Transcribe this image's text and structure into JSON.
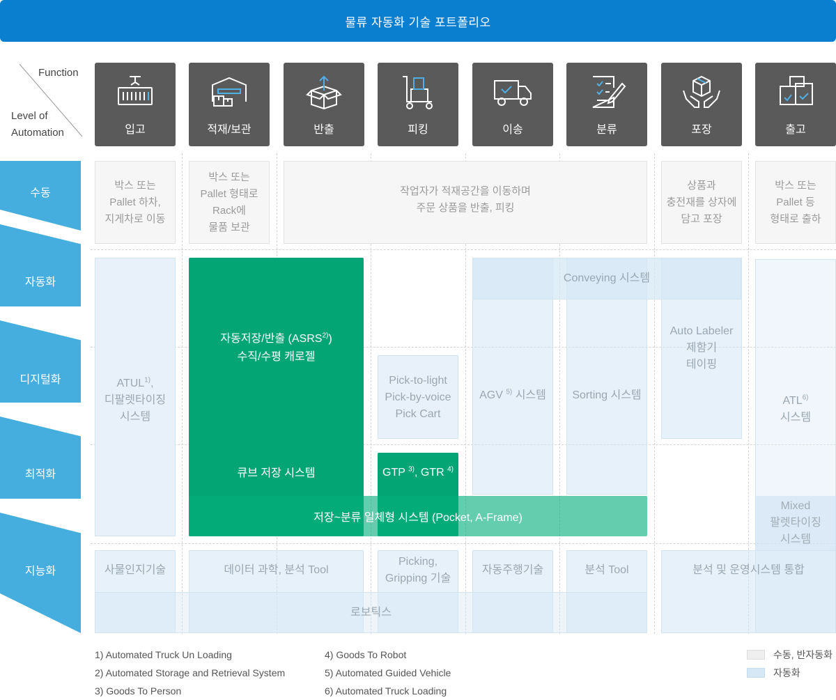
{
  "title": "물류 자동화 기술 포트폴리오",
  "axes": {
    "function_label": "Function",
    "level_label_1": "Level of",
    "level_label_2": "Automation"
  },
  "functions": [
    {
      "label": "입고",
      "icon": "container-crane-icon"
    },
    {
      "label": "적재/보관",
      "icon": "warehouse-boxes-icon"
    },
    {
      "label": "반출",
      "icon": "open-box-arrow-icon"
    },
    {
      "label": "피킹",
      "icon": "hand-truck-icon"
    },
    {
      "label": "이송",
      "icon": "delivery-truck-icon"
    },
    {
      "label": "분류",
      "icon": "checklist-pen-icon"
    },
    {
      "label": "포장",
      "icon": "hands-box-icon"
    },
    {
      "label": "출고",
      "icon": "stacked-boxes-icon"
    }
  ],
  "levels": [
    "수동",
    "자동화",
    "디지털화",
    "최적화",
    "지능화"
  ],
  "manual": {
    "inbound": [
      "박스 또는",
      "Pallet 하차,",
      "지게차로 이동"
    ],
    "storage": [
      "박스 또는",
      "Pallet 형태로",
      "Rack에",
      "물품 보관"
    ],
    "picking": [
      "작업자가 적재공간을 이동하며",
      "주문 상품을 반출, 피킹"
    ],
    "packing": [
      "상품과",
      "충전재를 상자에",
      "담고 포장"
    ],
    "outbound": [
      "박스 또는",
      "Pallet 등",
      "형태로 출하"
    ]
  },
  "automation": {
    "atul": {
      "text": "ATUL",
      "sup": "1)",
      "suffix": ",",
      "line2": "디팔렛타이징",
      "line3": "시스템"
    },
    "asrs": {
      "line1": "자동저장/반출 (ASRS",
      "sup": "2)",
      "line1_end": ")",
      "line2": "수직/수평 캐로젤"
    },
    "conveying": "Conveying 시스템",
    "pick_to_light": [
      "Pick-to-light",
      "Pick-by-voice",
      "Pick Cart"
    ],
    "agv": {
      "text": "AGV",
      "sup": "5)",
      "suffix": " 시스템"
    },
    "sorting": "Sorting 시스템",
    "auto_labeler": [
      "Auto Labeler",
      "제함기",
      "테이핑"
    ],
    "atl": {
      "text": "ATL",
      "sup": "6)",
      "line2": "시스템"
    },
    "cube": "큐브 저장 시스템",
    "gtp": {
      "a": "GTP",
      "sup_a": "3)",
      "mid": ", GTR",
      "sup_b": "4)"
    },
    "pocket": "저장~분류 일체형 시스템 (Pocket, A-Frame)",
    "mixed": [
      "Mixed",
      "팔렛타이징",
      "시스템"
    ]
  },
  "intelligence": {
    "iot": "사물인지기술",
    "data_science": "데이터 과학, 분석 Tool",
    "picking": [
      "Picking,",
      "Gripping 기술"
    ],
    "auto_driving": "자동주행기술",
    "analysis_tool": "분석 Tool",
    "integration": "분석 및 운영시스템 통합",
    "robotics": "로보틱스"
  },
  "footnotes": [
    "1) Automated Truck Un Loading",
    "2) Automated Storage and Retrieval System",
    "3) Goods To Person",
    "4) Goods To Robot",
    "5) Automated Guided Vehicle",
    "6) Automated Truck Loading"
  ],
  "legend": [
    {
      "label": "수동, 반자동화",
      "color": "#efefef"
    },
    {
      "label": "자동화",
      "color": "#d6e8f6"
    }
  ],
  "colors": {
    "banner": "#0a7fd0",
    "level": "#45aedf",
    "green": "#04a574",
    "function": "#5a5a5a"
  }
}
